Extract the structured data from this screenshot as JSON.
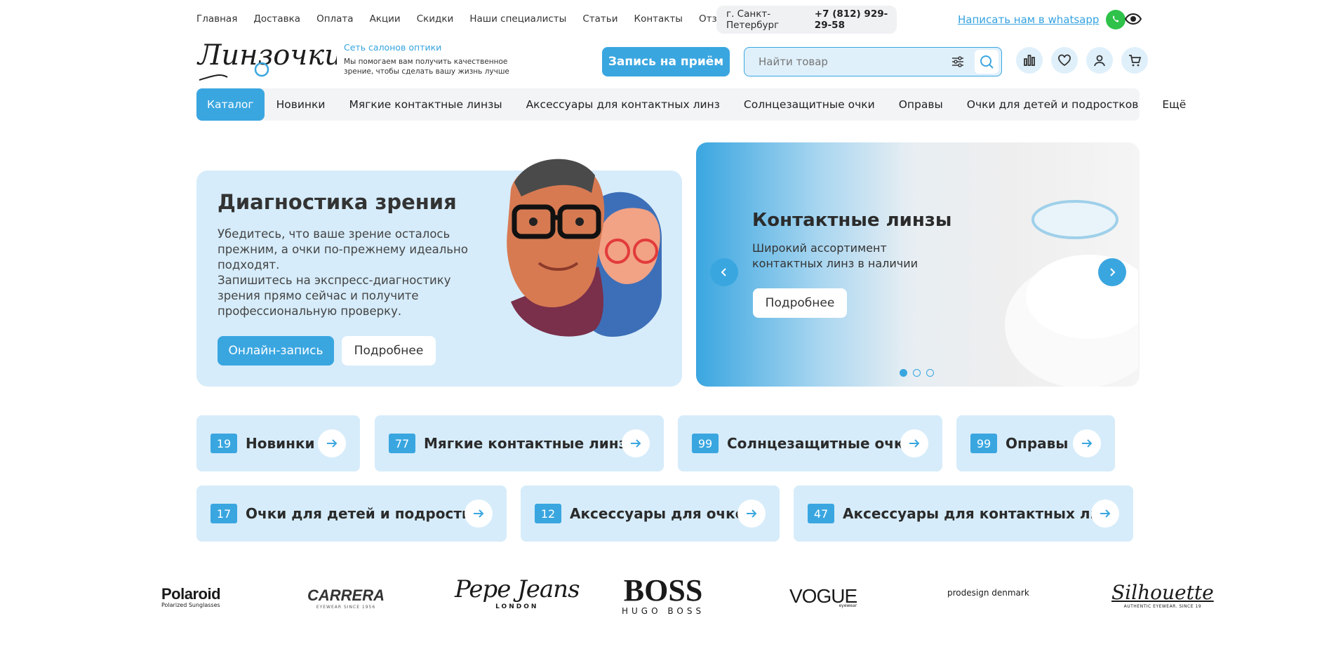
{
  "topbar": {
    "links": [
      "Главная",
      "Доставка",
      "Оплата",
      "Акции",
      "Скидки",
      "Наши специалисты",
      "Статьи",
      "Контакты",
      "Отзывы"
    ],
    "city": "г. Санкт-Петербург",
    "phone": "+7 (812) 929-29-58",
    "whatsapp_label": "Написать нам в whatsapp"
  },
  "header": {
    "logo_text": "Линзочки",
    "tagline_title": "Сеть салонов оптики",
    "tagline_text": "Мы помогаем вам получить качественное зрение, чтобы сделать вашу жизнь лучше",
    "appointment_button": "Запись на приём",
    "search_placeholder": "Найти товар"
  },
  "nav": {
    "items": [
      "Каталог",
      "Новинки",
      "Мягкие контактные линзы",
      "Аксессуары для контактных линз",
      "Солнцезащитные очки",
      "Оправы",
      "Очки для детей и подростков",
      "Ещё"
    ]
  },
  "hero_left": {
    "title": "Диагностика зрения",
    "text": "Убедитесь, что ваше зрение осталось прежним, а очки по-прежнему идеально подходят.\nЗапишитесь на экспресс-диагностику зрения прямо сейчас и получите профессиональную проверку.",
    "primary_button": "Онлайн-запись",
    "secondary_button": "Подробнее"
  },
  "hero_right": {
    "title": "Контактные линзы",
    "text": "Широкий ассортимент контактных линз в наличии",
    "button": "Подробнее",
    "active_slide": 1,
    "slides_total": 3
  },
  "categories": [
    {
      "count": "19",
      "name": "Новинки"
    },
    {
      "count": "77",
      "name": "Мягкие контактные линзы"
    },
    {
      "count": "99",
      "name": "Солнцезащитные очки"
    },
    {
      "count": "99",
      "name": "Оправы"
    },
    {
      "count": "17",
      "name": "Очки для детей и подростков"
    },
    {
      "count": "12",
      "name": "Аксессуары для очков"
    },
    {
      "count": "47",
      "name": "Аксессуары для контактных линз"
    }
  ],
  "brands": [
    {
      "name": "Polaroid",
      "sub": "Polarized Sunglasses"
    },
    {
      "name": "CARRERA",
      "sub": "EYEWEAR SINCE 1956"
    },
    {
      "name": "Pepe Jeans",
      "sub": "LONDON"
    },
    {
      "name": "BOSS",
      "sub": "HUGO BOSS"
    },
    {
      "name": "VOGUE",
      "sub": "eyewear"
    },
    {
      "name": "prodesign denmark",
      "sub": ""
    },
    {
      "name": "Silhouette",
      "sub": "AUTHENTIC EYEWEAR. SINCE 19"
    }
  ],
  "colors": {
    "accent": "#3aa6e0",
    "tile_bg": "#d6ecfa",
    "whatsapp": "#2fc24a"
  }
}
